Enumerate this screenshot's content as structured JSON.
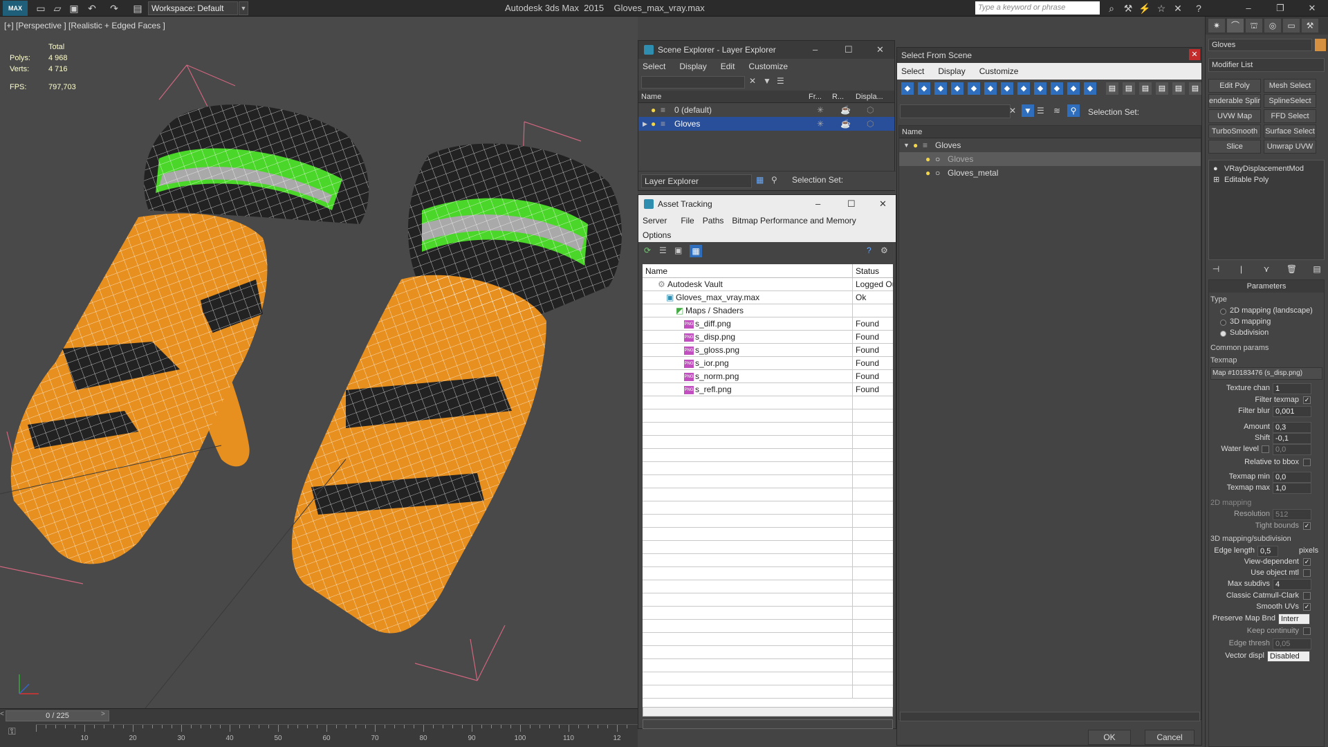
{
  "titlebar": {
    "app_name": "Autodesk 3ds Max  2015",
    "file_name": "Gloves_max_vray.max",
    "logo": "MAX",
    "workspace": "Workspace: Default",
    "search_placeholder": "Type a keyword or phrase"
  },
  "viewport": {
    "label": "[+] [Perspective ] [Realistic + Edged Faces ]",
    "stats": {
      "total_label": "Total",
      "polys_label": "Polys:",
      "polys_value": "4 968",
      "verts_label": "Verts:",
      "verts_value": "4 716",
      "fps_label": "FPS:",
      "fps_value": "797,703"
    },
    "colors": {
      "glove": "#e8901f",
      "band_green": "#4bd62a",
      "band_grey": "#a9a9a9",
      "strap": "#222222",
      "wire": "#ffffff",
      "bbox": "#d0667f"
    }
  },
  "timeline": {
    "slider": "0 / 225",
    "ticks": [
      "10",
      "20",
      "30",
      "40",
      "50",
      "60",
      "70",
      "80",
      "90",
      "100",
      "110",
      "12"
    ]
  },
  "scene_explorer": {
    "title": "Scene Explorer - Layer Explorer",
    "menu": [
      "Select",
      "Display",
      "Edit",
      "Customize"
    ],
    "columns": {
      "name": "Name",
      "frozen": "Fr...",
      "render": "R...",
      "display": "Displa..."
    },
    "rows": [
      {
        "label": "0 (default)"
      },
      {
        "label": "Gloves"
      }
    ],
    "explorer_dropdown": "Layer Explorer",
    "selection_set": "Selection Set:"
  },
  "asset_tracking": {
    "title": "Asset Tracking",
    "menu": [
      "Server",
      "File",
      "Paths",
      "Bitmap Performance and Memory"
    ],
    "menu2": "Options",
    "columns": {
      "name": "Name",
      "status": "Status"
    },
    "rows": [
      {
        "name": "Autodesk Vault",
        "status": "Logged Ou"
      },
      {
        "name": "Gloves_max_vray.max",
        "status": "Ok"
      },
      {
        "name": "Maps / Shaders",
        "status": ""
      },
      {
        "name": "s_diff.png",
        "status": "Found"
      },
      {
        "name": "s_disp.png",
        "status": "Found"
      },
      {
        "name": "s_gloss.png",
        "status": "Found"
      },
      {
        "name": "s_ior.png",
        "status": "Found"
      },
      {
        "name": "s_norm.png",
        "status": "Found"
      },
      {
        "name": "s_refl.png",
        "status": "Found"
      }
    ]
  },
  "select_from_scene": {
    "title": "Select From Scene",
    "menu": [
      "Select",
      "Display",
      "Customize"
    ],
    "selection_set": "Selection Set:",
    "column_name": "Name",
    "tree": [
      {
        "label": "Gloves"
      },
      {
        "label": "Gloves"
      },
      {
        "label": "Gloves_metal"
      }
    ],
    "ok": "OK",
    "cancel": "Cancel"
  },
  "command_panel": {
    "object_name": "Gloves",
    "modifier_list": "Modifier List",
    "modifier_buttons": [
      "Edit Poly",
      "Mesh Select",
      "enderable Splir",
      "SplineSelect",
      "UVW Map",
      "FFD Select",
      "TurboSmooth",
      "Surface Select",
      "Slice",
      "Unwrap UVW"
    ],
    "stack": [
      "VRayDisplacementMod",
      "Editable Poly"
    ],
    "params": {
      "header": "Parameters",
      "type_label": "Type",
      "type_options": [
        "2D mapping (landscape)",
        "3D mapping",
        "Subdivision"
      ],
      "type_selected": "Subdivision",
      "common_label": "Common params",
      "texmap_label": "Texmap",
      "texmap_value": "Map #10183476 (s_disp.png)",
      "texture_chan_label": "Texture chan",
      "texture_chan": "1",
      "filter_texmap_label": "Filter texmap",
      "filter_blur_label": "Filter blur",
      "filter_blur": "0,001",
      "amount_label": "Amount",
      "amount": "0,3",
      "shift_label": "Shift",
      "shift": "-0,1",
      "water_level_label": "Water level",
      "water_level": "0,0",
      "relative_bbox_label": "Relative to bbox",
      "texmap_min_label": "Texmap min",
      "texmap_min": "0,0",
      "texmap_max_label": "Texmap max",
      "texmap_max": "1,0",
      "mapping2d_label": "2D mapping",
      "resolution_label": "Resolution",
      "resolution": "512",
      "tight_bounds_label": "Tight bounds",
      "mapping3d_label": "3D mapping/subdivision",
      "edge_length_label": "Edge length",
      "edge_length": "0,5",
      "pixels_label": "pixels",
      "view_dependent_label": "View-dependent",
      "use_object_mtl_label": "Use object mtl",
      "max_subdivs_label": "Max subdivs",
      "max_subdivs": "4",
      "catmull_label": "Classic Catmull-Clark",
      "smooth_uvs_label": "Smooth UVs",
      "preserve_map_label": "Preserve Map Bnd",
      "preserve_map": "Interr",
      "keep_continuity_label": "Keep continuity",
      "edge_thresh_label": "Edge thresh",
      "edge_thresh": "0,05",
      "vector_displ_label": "Vector displ",
      "vector_displ": "Disabled"
    }
  }
}
